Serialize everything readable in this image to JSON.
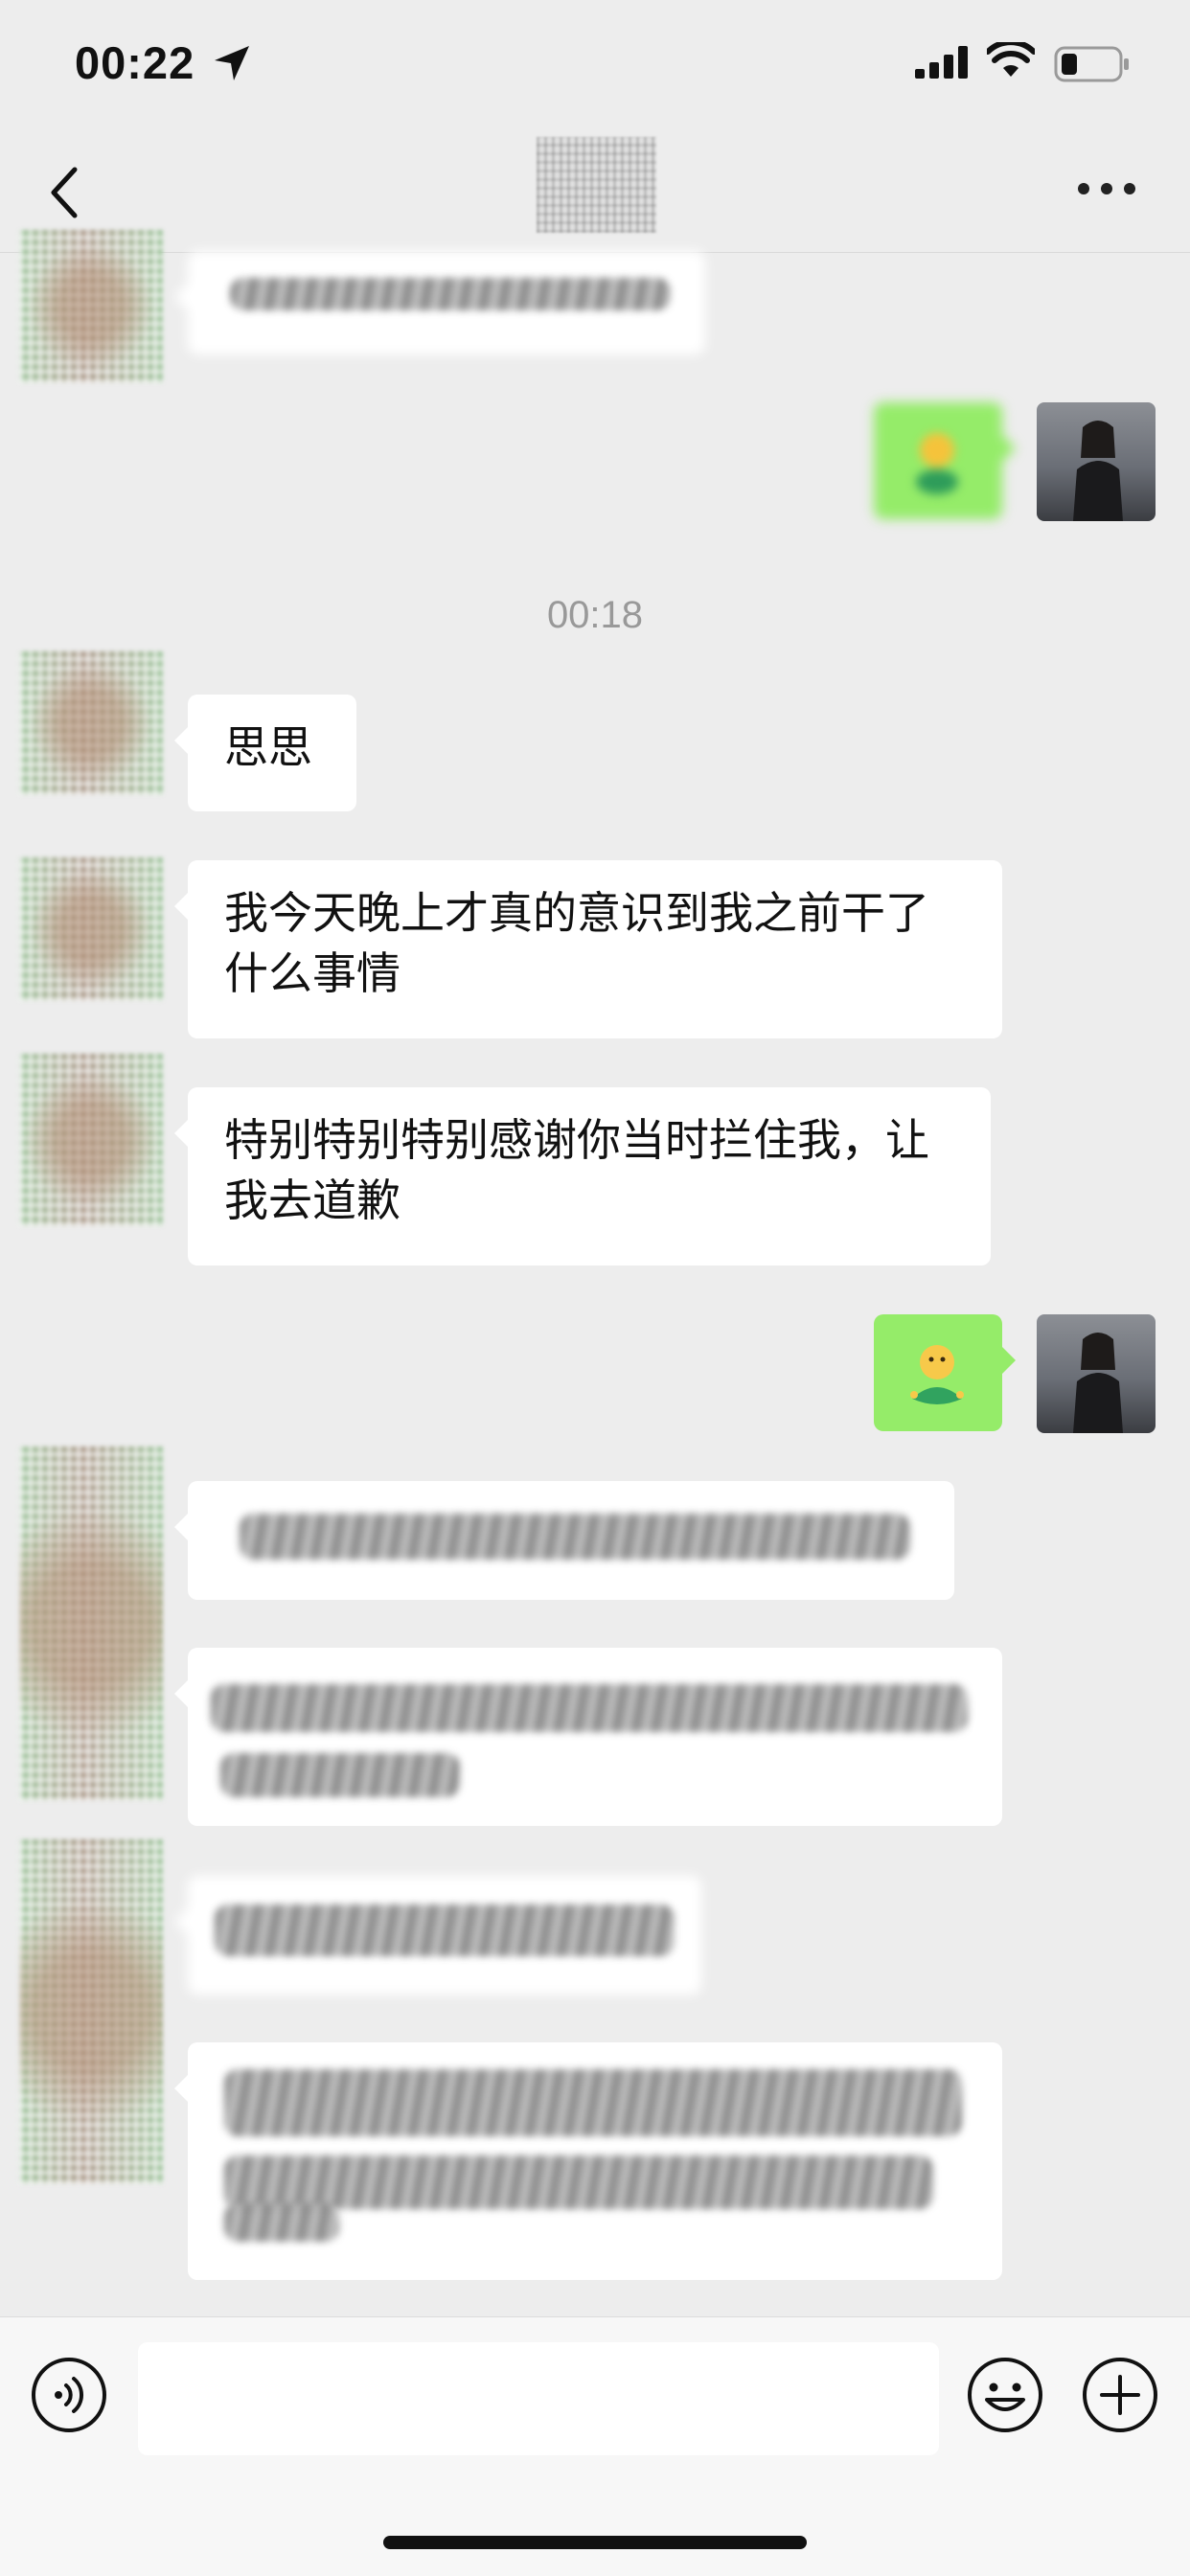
{
  "status": {
    "time": "00:22"
  },
  "chat": {
    "timestamp": "00:18",
    "messages": [
      {
        "side": "left",
        "text": "思思"
      },
      {
        "side": "left",
        "text": "我今天晚上才真的意识到我之前干了什么事情"
      },
      {
        "side": "left",
        "text": "特别特别特别感谢你当时拦住我，让我去道歉"
      }
    ]
  },
  "colors": {
    "accent_green": "#95ec69",
    "background": "#ededed",
    "bubble": "#ffffff"
  },
  "icons": [
    "location-arrow-icon",
    "signal-icon",
    "wifi-icon",
    "battery-icon",
    "back-chevron-icon",
    "more-icon",
    "voice-icon",
    "emoji-icon",
    "plus-icon"
  ]
}
